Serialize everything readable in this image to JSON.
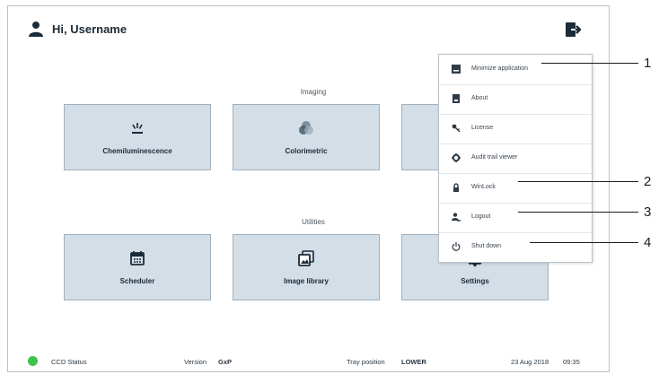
{
  "header": {
    "greeting": "Hi, Username"
  },
  "sections": {
    "imaging": "Imaging",
    "utilities": "Utilities"
  },
  "tiles": {
    "chemiluminescence": "Chemiluminescence",
    "colorimetric": "Colorimetric",
    "scheduler": "Scheduler",
    "image_library": "Image library",
    "settings": "Settings"
  },
  "menu": {
    "items": [
      {
        "label": "Minimize application",
        "icon": "minimize-icon"
      },
      {
        "label": "About",
        "icon": "about-icon"
      },
      {
        "label": "License",
        "icon": "key-icon"
      },
      {
        "label": "Audit trail viewer",
        "icon": "audit-icon"
      },
      {
        "label": "WinLock",
        "icon": "lock-icon"
      },
      {
        "label": "Logout",
        "icon": "logout-icon"
      },
      {
        "label": "Shut down",
        "icon": "power-icon"
      }
    ]
  },
  "callouts": [
    "1",
    "2",
    "3",
    "4"
  ],
  "status": {
    "ccd": "CCD Status",
    "ccd_color": "#3ec24a",
    "version_label": "Version",
    "version_value": "GxP",
    "tray_label": "Tray position",
    "tray_value": "LOWER",
    "date": "23 Aug 2018",
    "time": "09:35"
  }
}
